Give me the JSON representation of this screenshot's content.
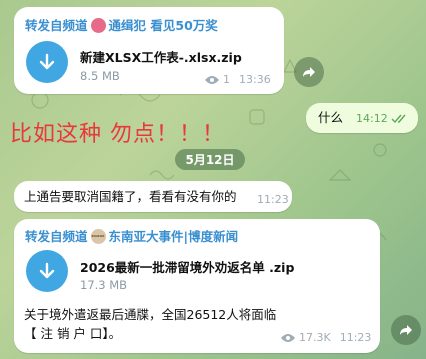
{
  "colors": {
    "accent": "#40a7e3",
    "overlay": "#e8383b",
    "outgoing": "#effdde"
  },
  "post1": {
    "forward_label": "转发自频道",
    "channel_name": "通缉犯 看见50万奖",
    "file_name": "新建XLSX工作表-.xlsx.zip",
    "file_size": "8.5 MB",
    "views": "1",
    "time": "13:36",
    "file_icon": "download-arrow-icon"
  },
  "outgoing": {
    "text": "什么",
    "time": "14:12"
  },
  "overlay_text": "比如这种 勿点！！！",
  "date_separator": "5月12日",
  "text_message": {
    "text": "上通告要取消国籍了，看看有没有你的",
    "time": "11:23"
  },
  "post2": {
    "forward_label": "转发自频道",
    "channel_name": "东南亚大事件|博度新闻",
    "avatar_text": "BIGBOX",
    "file_name": "2026最新一批滞留境外劝返名单 .zip",
    "file_size": "17.3 MB",
    "caption": "关于境外遣返最后通牒，全国26512人将面临【 注 销 户 口】。",
    "views": "17.3K",
    "time": "11:23",
    "file_icon": "download-arrow-icon"
  }
}
